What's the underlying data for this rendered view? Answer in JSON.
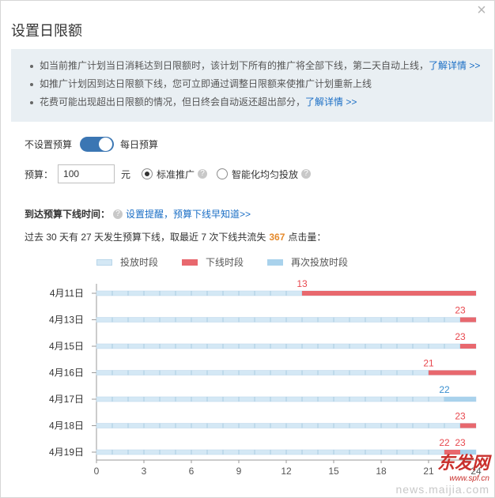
{
  "dialog": {
    "title": "设置日限额",
    "close_glyph": "×"
  },
  "notice": {
    "items": [
      {
        "text": "如当前推广计划当日消耗达到日限额时，该计划下所有的推广将全部下线，第二天自动上线，",
        "link": "了解详情 >>"
      },
      {
        "text": "如推广计划因到达日限额下线，您可立即通过调整日限额来使推广计划重新上线",
        "link": ""
      },
      {
        "text": "花费可能出现超出日限额的情况，但日终会自动返还超出部分，",
        "link": "了解详情 >>"
      }
    ]
  },
  "budget_toggle": {
    "off_label": "不设置预算",
    "on_label": "每日预算",
    "state": "on"
  },
  "budget": {
    "label": "预算：",
    "value": "100",
    "unit": "元",
    "options": [
      {
        "label": "标准推广",
        "selected": true
      },
      {
        "label": "智能化均匀投放",
        "selected": false
      }
    ]
  },
  "offline": {
    "label": "到达预算下线时间：",
    "link": "设置提醒，预算下线早知道>>",
    "summary_prefix": "过去 30 天有 27 天发生预算下线，取最近 7 次下线共流失",
    "lost_clicks": "367",
    "summary_suffix": "点击量："
  },
  "colors": {
    "delivery": "#d4e8f5",
    "offline": "#e8686e",
    "redelivery": "#a9d2ec",
    "label_red": "#e8484e",
    "label_blue": "#3a8fd0"
  },
  "chart_data": {
    "type": "bar",
    "orientation": "horizontal",
    "legend": [
      "投放时段",
      "下线时段",
      "再次投放时段"
    ],
    "x_ticks": [
      0,
      3,
      6,
      9,
      12,
      15,
      18,
      21,
      24
    ],
    "xlim": [
      0,
      24
    ],
    "rows": [
      {
        "date": "4月11日",
        "segments": [
          {
            "type": "offline",
            "start": 13,
            "end": 24
          }
        ],
        "labels": [
          {
            "text": "13",
            "at": 13,
            "color": "red"
          }
        ]
      },
      {
        "date": "4月13日",
        "segments": [
          {
            "type": "offline",
            "start": 23,
            "end": 24
          }
        ],
        "labels": [
          {
            "text": "23",
            "at": 23,
            "color": "red"
          }
        ]
      },
      {
        "date": "4月15日",
        "segments": [
          {
            "type": "offline",
            "start": 23,
            "end": 24
          }
        ],
        "labels": [
          {
            "text": "23",
            "at": 23,
            "color": "red"
          }
        ]
      },
      {
        "date": "4月16日",
        "segments": [
          {
            "type": "offline",
            "start": 21,
            "end": 24
          }
        ],
        "labels": [
          {
            "text": "21",
            "at": 21,
            "color": "red"
          }
        ]
      },
      {
        "date": "4月17日",
        "segments": [
          {
            "type": "redelivery",
            "start": 22,
            "end": 24
          }
        ],
        "labels": [
          {
            "text": "22",
            "at": 22,
            "color": "blue"
          }
        ]
      },
      {
        "date": "4月18日",
        "segments": [
          {
            "type": "offline",
            "start": 23,
            "end": 24
          }
        ],
        "labels": [
          {
            "text": "23",
            "at": 23,
            "color": "red"
          }
        ]
      },
      {
        "date": "4月19日",
        "segments": [
          {
            "type": "offline",
            "start": 22,
            "end": 23
          },
          {
            "type": "redelivery",
            "start": 23,
            "end": 24
          }
        ],
        "labels": [
          {
            "text": "22",
            "at": 22,
            "color": "red"
          },
          {
            "text": "23",
            "at": 23,
            "color": "red"
          }
        ]
      }
    ]
  },
  "watermark": {
    "brand": "东发网",
    "url": "www.spf.cn",
    "news": "news.maijia.com"
  }
}
